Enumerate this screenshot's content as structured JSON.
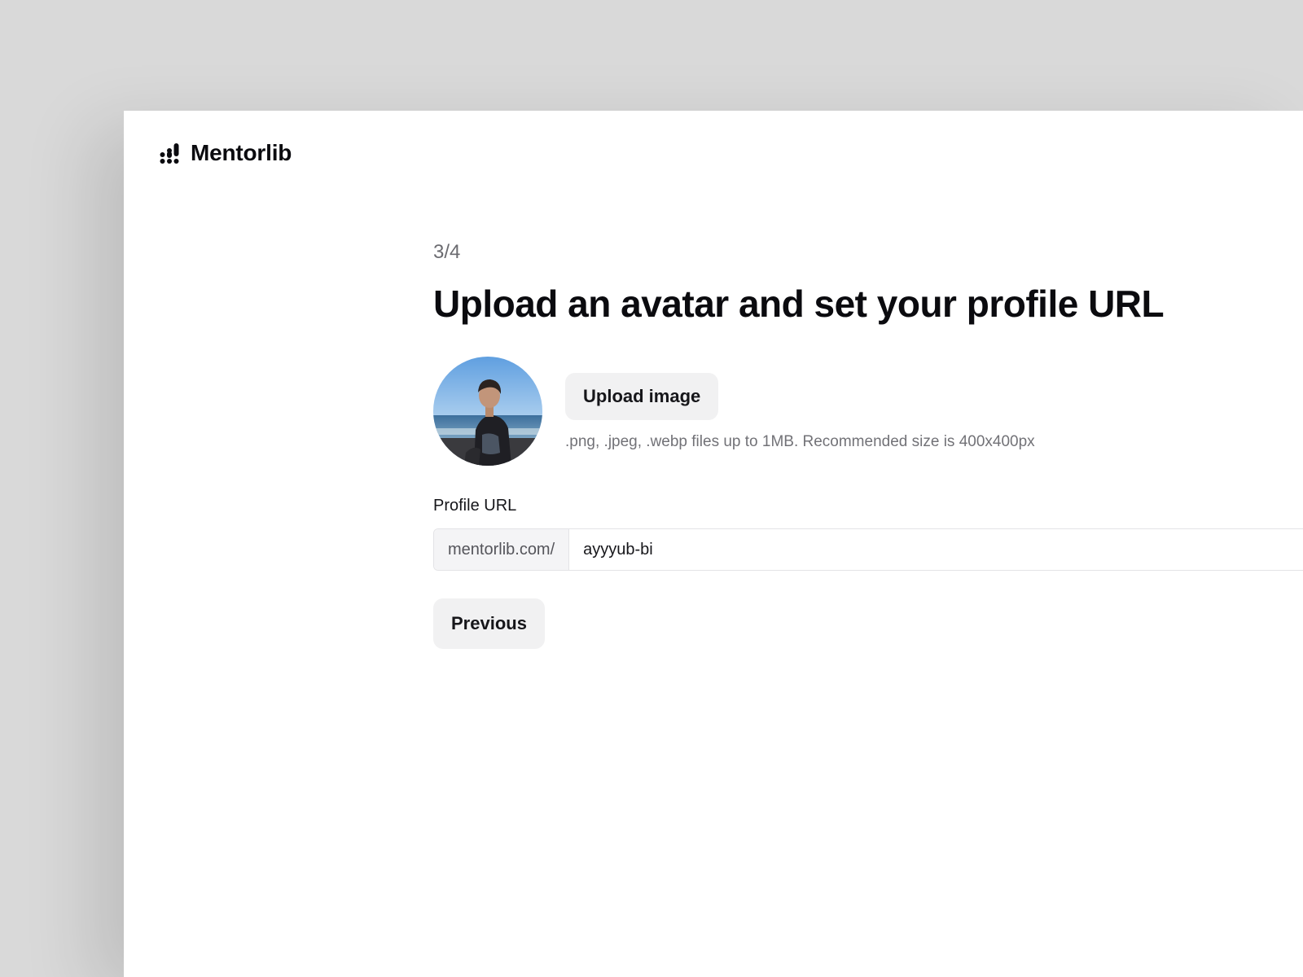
{
  "brand": {
    "name": "Mentorlib",
    "icon": "mentorlib-logo-icon"
  },
  "step": {
    "indicator": "3/4"
  },
  "page": {
    "title": "Upload an avatar and set your profile URL"
  },
  "avatar": {
    "icon": "user-avatar-photo"
  },
  "upload": {
    "button_label": "Upload image",
    "hint": ".png, .jpeg, .webp files up to 1MB. Recommended size is 400x400px"
  },
  "profile_url": {
    "label": "Profile URL",
    "prefix": "mentorlib.com/",
    "value": "ayyyub-bi"
  },
  "navigation": {
    "previous_label": "Previous"
  },
  "colors": {
    "background": "#d9d9d9",
    "surface": "#ffffff",
    "button_bg": "#f1f1f2",
    "text_primary": "#0b0b0f",
    "text_muted": "#727277"
  }
}
